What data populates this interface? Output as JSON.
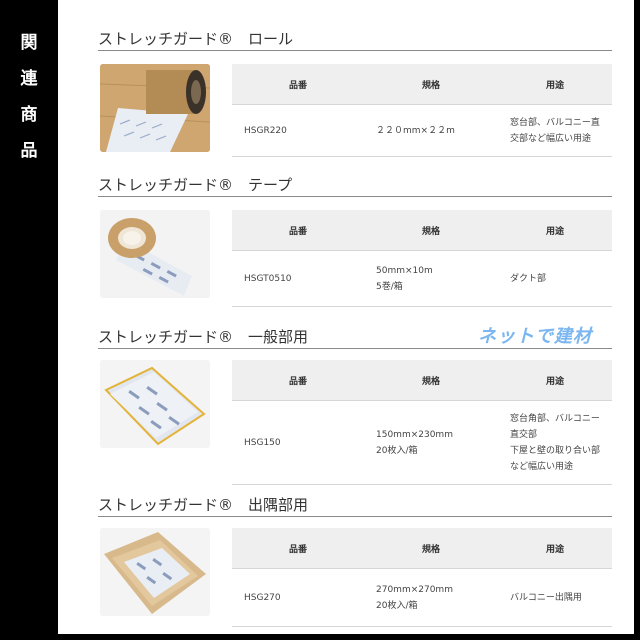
{
  "side_label": [
    "関",
    "連",
    "商",
    "品"
  ],
  "table_headers": [
    "品番",
    "規格",
    "用途"
  ],
  "watermark": "ネットで建材",
  "sections": [
    {
      "title": "ストレッチガード®　ロール",
      "row": {
        "code": "HSGR220",
        "spec": "２２０mm×２２m",
        "use": "窓台部、バルコニー直\n交部など幅広い用途"
      }
    },
    {
      "title": "ストレッチガード®　テープ",
      "row": {
        "code": "HSGT0510",
        "spec": "50mm×10m\n5巻/箱",
        "use": "ダクト部"
      }
    },
    {
      "title": "ストレッチガード®　一般部用",
      "row": {
        "code": "HSG150",
        "spec": "150mm×230mm\n20枚入/箱",
        "use": "窓台角部、バルコニー\n直交部\n下屋と壁の取り合い部\nなど幅広い用途"
      }
    },
    {
      "title": "ストレッチガード®　出隅部用",
      "row": {
        "code": "HSG270",
        "spec": "270mm×270mm\n20枚入/箱",
        "use": "バルコニー出隅用"
      }
    }
  ]
}
